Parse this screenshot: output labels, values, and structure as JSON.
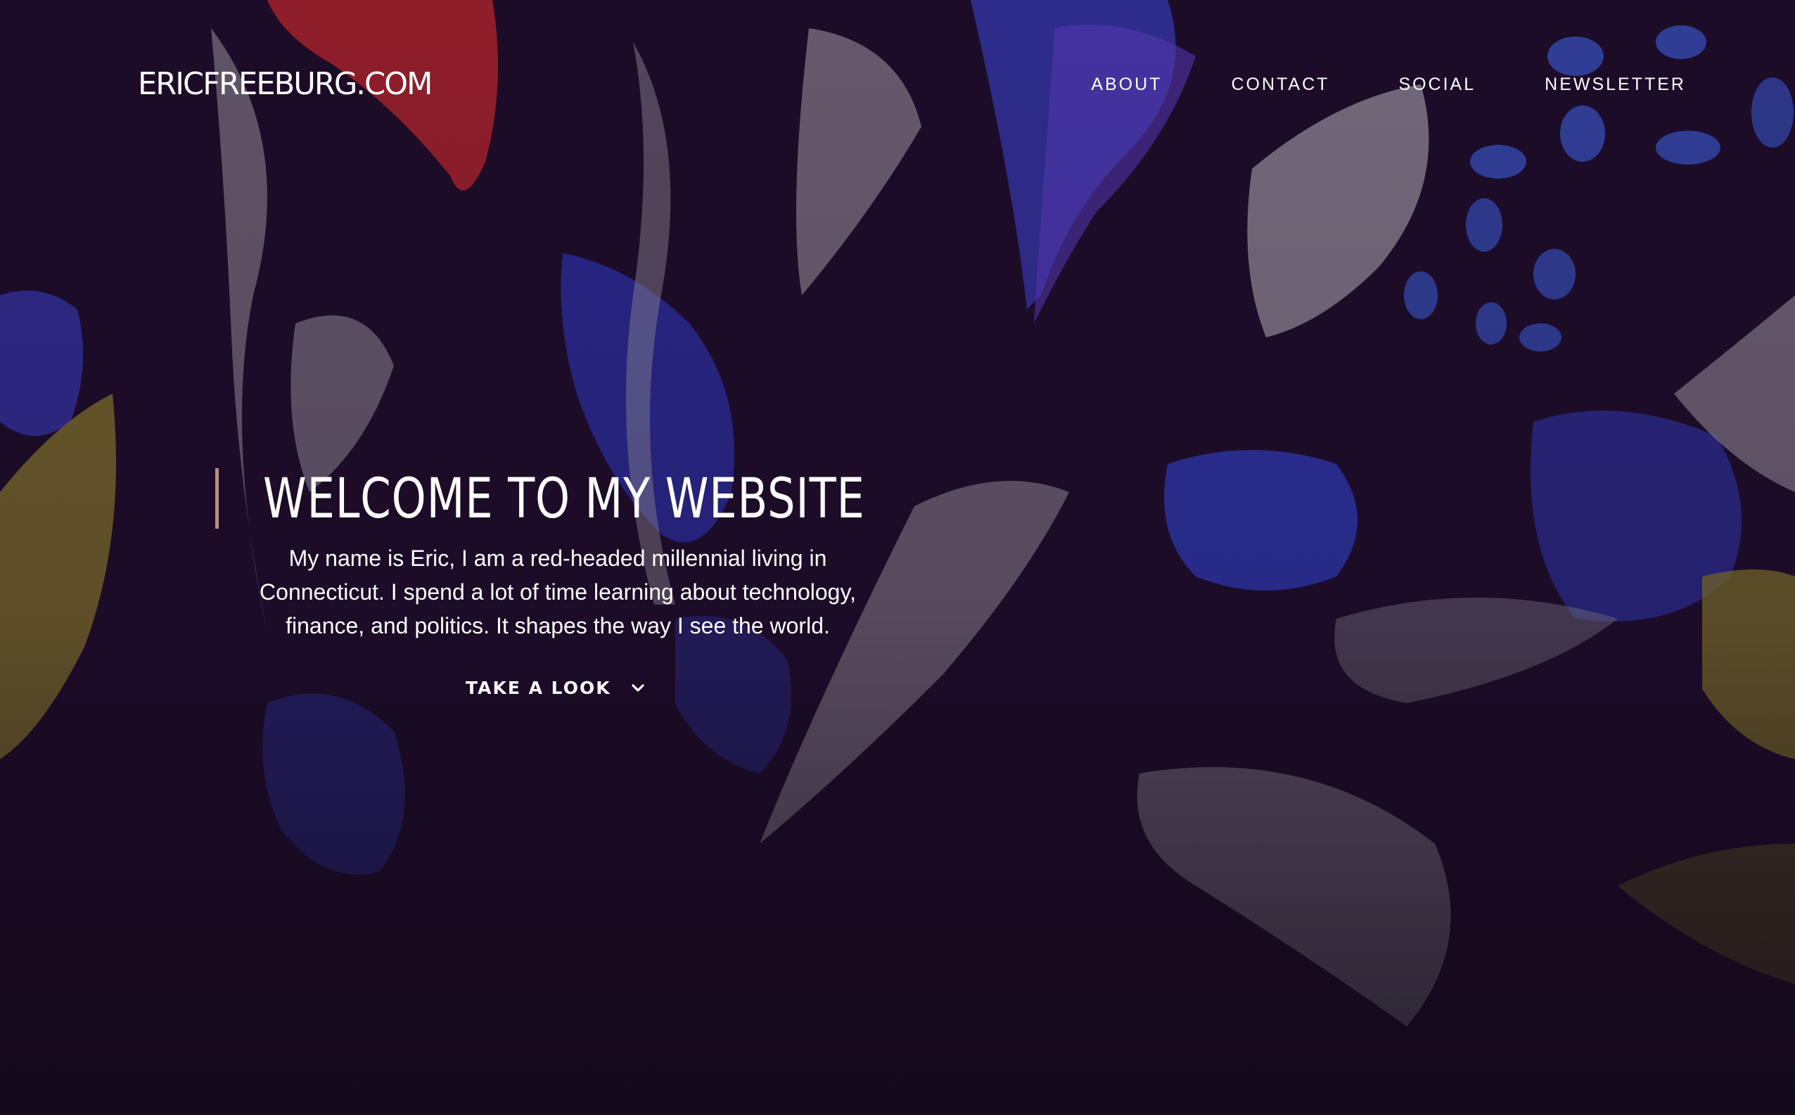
{
  "header": {
    "logo": "ERICFREEBURG.COM",
    "nav": [
      "ABOUT",
      "CONTACT",
      "SOCIAL",
      "NEWSLETTER"
    ]
  },
  "hero": {
    "title": "WELCOME TO MY WEBSITE",
    "text": "My name is Eric, I am a red-headed millennial living in Connecticut. I spend a lot of time learning about technology, finance, and politics. It shapes the way I see the world.",
    "cta_label": "TAKE A LOOK",
    "cta_icon": "chevron-down-icon"
  },
  "colors": {
    "background": "#1c0c28",
    "accent_bar": "#b89378",
    "text": "#ffffff",
    "art_blue": "#3a3fc4",
    "art_grey": "#a9a7ad",
    "art_red": "#b3232b",
    "art_yellow": "#8c7d2a"
  }
}
